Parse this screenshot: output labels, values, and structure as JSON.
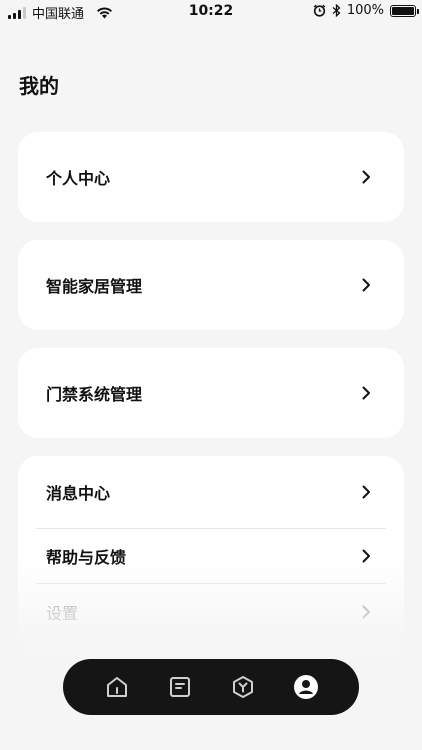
{
  "status_bar": {
    "carrier": "中国联通",
    "time": "10:22",
    "battery": "100%",
    "icons": [
      "signal-icon",
      "wifi-icon",
      "alarm-icon",
      "bluetooth-icon",
      "battery-icon"
    ]
  },
  "page": {
    "title": "我的"
  },
  "menu": {
    "personal_center": "个人中心",
    "smart_home": "智能家居管理",
    "access_control": "门禁系统管理",
    "messages": "消息中心",
    "help_feedback": "帮助与反馈",
    "settings": "设置"
  },
  "tabbar": {
    "tabs": [
      {
        "icon": "home-icon",
        "active": false
      },
      {
        "icon": "document-icon",
        "active": false
      },
      {
        "icon": "hexagon-y-icon",
        "active": false
      },
      {
        "icon": "profile-icon",
        "active": true
      }
    ]
  },
  "colors": {
    "background": "#f5f5f5",
    "card": "#ffffff",
    "tabbar": "#151515",
    "text": "#111111",
    "muted_text": "#8a8a8a"
  }
}
